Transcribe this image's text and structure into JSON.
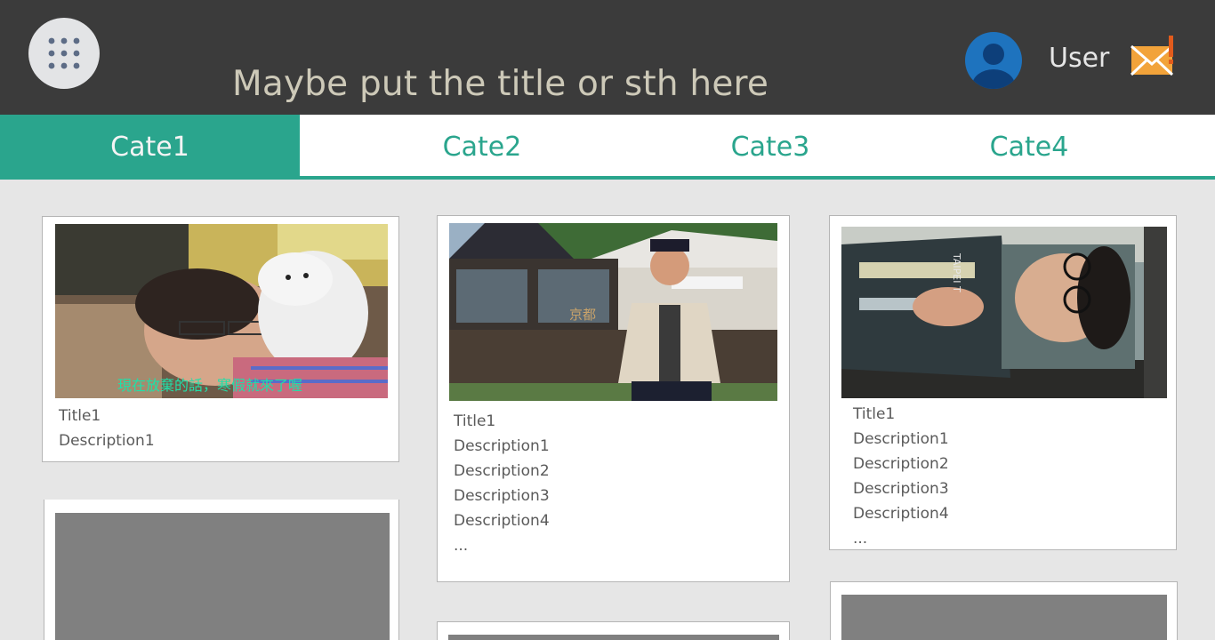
{
  "header": {
    "title": "Maybe put the title or sth here",
    "user_name": "User",
    "colors": {
      "bar": "#3b3b3b",
      "title_text": "#cdc9b8",
      "mail": "#f2a33a",
      "mail_alert": "#e25b1c",
      "avatar": "#1e73be"
    },
    "icons": {
      "apps": "apps-grid-icon",
      "avatar": "user-avatar-icon",
      "mail": "mail-alert-icon"
    }
  },
  "tabs": [
    {
      "label": "Cate1",
      "active": true
    },
    {
      "label": "Cate2",
      "active": false
    },
    {
      "label": "Cate3",
      "active": false
    },
    {
      "label": "Cate4",
      "active": false
    }
  ],
  "accent_color": "#2aa58d",
  "cards": [
    {
      "title": "Title1",
      "descriptions": [
        "Description1"
      ],
      "caption": "現在放棄的話，寒假就來了喔"
    },
    {
      "title": "Title1",
      "descriptions": [
        "Description1",
        "Description2",
        "Description3",
        "Description4",
        "..."
      ],
      "signage": "京都"
    },
    {
      "title": "Title1",
      "descriptions": [
        "Description1",
        "Description2",
        "Description3",
        "Description4",
        "..."
      ],
      "shirt_text": "TAIPEI T"
    }
  ]
}
